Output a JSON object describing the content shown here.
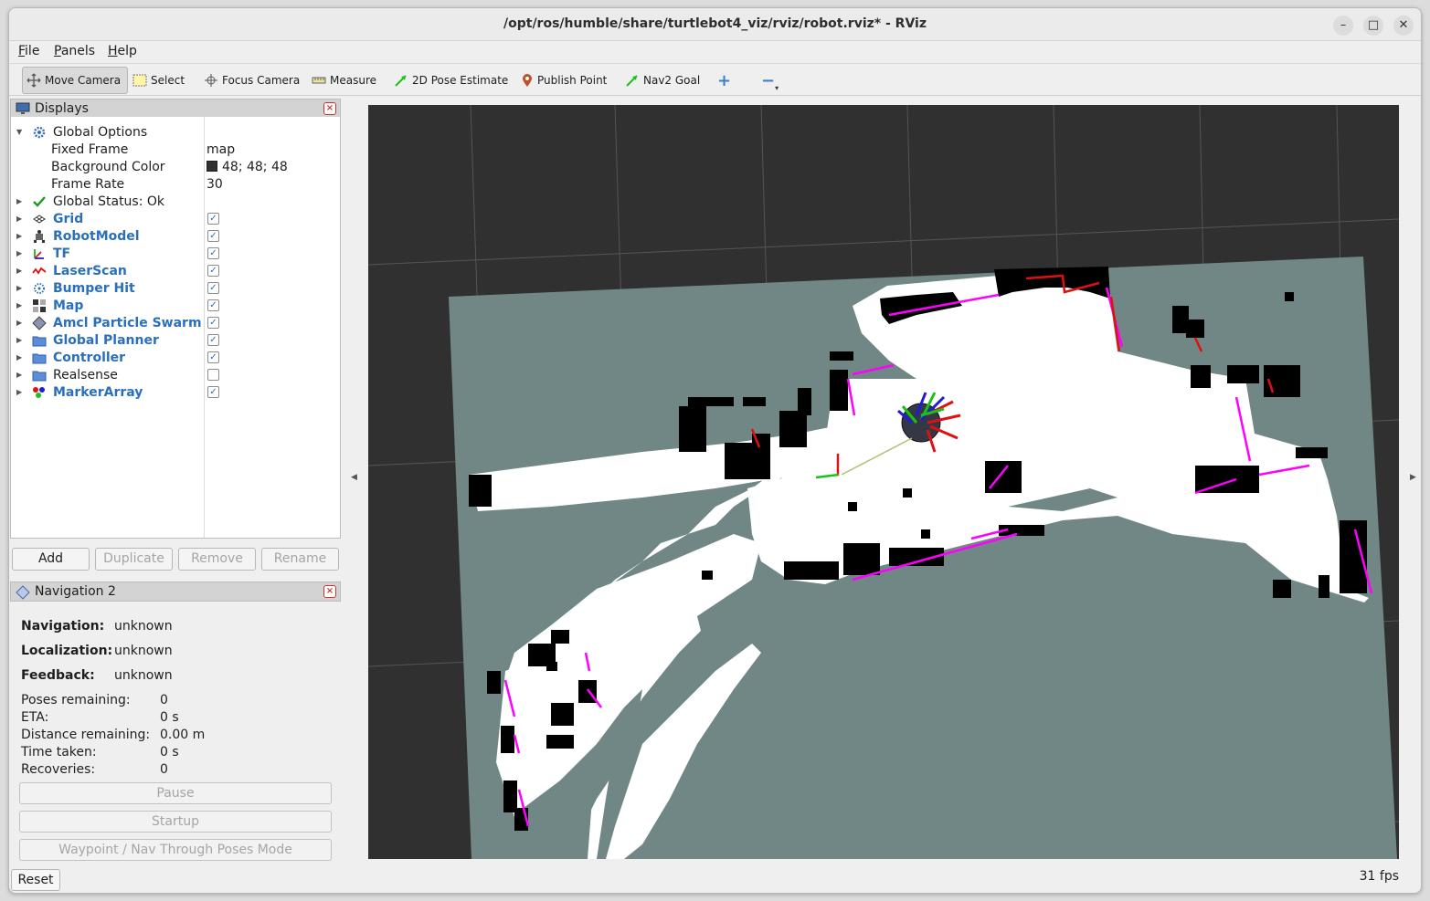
{
  "window": {
    "title": "/opt/ros/humble/share/turtlebot4_viz/rviz/robot.rviz* - RViz",
    "minimize": "–",
    "maximize": "□",
    "close": "✕"
  },
  "menu": [
    {
      "u": "F",
      "rest": "ile"
    },
    {
      "u": "P",
      "rest": "anels"
    },
    {
      "u": "H",
      "rest": "elp"
    }
  ],
  "toolbar": {
    "move_camera": "Move Camera",
    "select": "Select",
    "focus_camera": "Focus Camera",
    "measure": "Measure",
    "pose_estimate": "2D Pose Estimate",
    "publish_point": "Publish Point",
    "nav2_goal": "Nav2 Goal",
    "plus": "+",
    "minus": "−",
    "minus_sub": "▾"
  },
  "displays": {
    "title": "Displays",
    "close": "×",
    "global_options": "Global Options",
    "fixed_frame_label": "Fixed Frame",
    "fixed_frame_value": "map",
    "bg_color_label": "Background Color",
    "bg_color_value": "48; 48; 48",
    "bg_color_hex": "#303030",
    "frame_rate_label": "Frame Rate",
    "frame_rate_value": "30",
    "global_status": "Global Status: Ok",
    "items": [
      {
        "name": "Grid",
        "checked": true
      },
      {
        "name": "RobotModel",
        "checked": true
      },
      {
        "name": "TF",
        "checked": true
      },
      {
        "name": "LaserScan",
        "checked": true
      },
      {
        "name": "Bumper Hit",
        "checked": true
      },
      {
        "name": "Map",
        "checked": true
      },
      {
        "name": "Amcl Particle Swarm",
        "checked": true
      },
      {
        "name": "Global Planner",
        "checked": true
      },
      {
        "name": "Controller",
        "checked": true
      },
      {
        "name": "Realsense",
        "checked": false
      },
      {
        "name": "MarkerArray",
        "checked": true
      }
    ],
    "check_mark": "✓",
    "buttons": {
      "add": "Add",
      "duplicate": "Duplicate",
      "remove": "Remove",
      "rename": "Rename"
    }
  },
  "nav2": {
    "title": "Navigation 2",
    "close": "×",
    "navigation_label": "Navigation:",
    "navigation_value": "unknown",
    "localization_label": "Localization:",
    "localization_value": "unknown",
    "feedback_label": "Feedback:",
    "feedback_value": "unknown",
    "poses_remaining_label": "Poses remaining:",
    "poses_remaining_value": "0",
    "eta_label": "ETA:",
    "eta_value": "0 s",
    "distance_label": "Distance remaining:",
    "distance_value": "0.00 m",
    "time_taken_label": "Time taken:",
    "time_taken_value": "0 s",
    "recoveries_label": "Recoveries:",
    "recoveries_value": "0",
    "pause": "Pause",
    "startup": "Startup",
    "waypoint_mode": "Waypoint / Nav Through Poses Mode"
  },
  "footer": {
    "reset": "Reset",
    "fps": "31 fps"
  },
  "colors": {
    "accent": "#2a6fbd",
    "viewport_bg": "#303030",
    "map_unknown": "#708785",
    "map_free": "#ffffff",
    "map_occupied": "#000000",
    "scan": "#ff00ff"
  }
}
